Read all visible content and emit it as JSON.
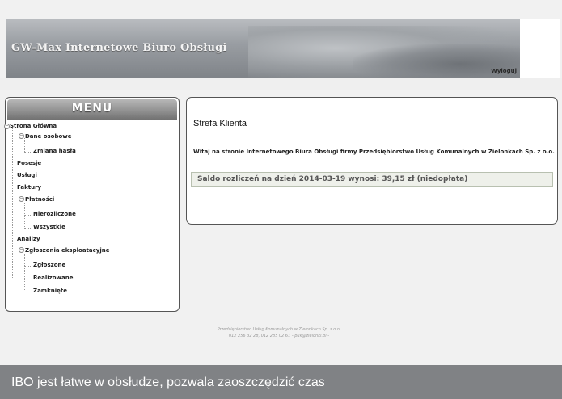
{
  "header": {
    "title": "GW-Max Internetowe Biuro Obsługi",
    "logout": "Wyloguj"
  },
  "menu": {
    "title": "MENU",
    "items": [
      {
        "label": "Strona Główna"
      },
      {
        "label": "Dane osobowe"
      },
      {
        "label": "Zmiana hasła"
      },
      {
        "label": "Posesje"
      },
      {
        "label": "Usługi"
      },
      {
        "label": "Faktury"
      },
      {
        "label": "Płatności"
      },
      {
        "label": "Nierozliczone"
      },
      {
        "label": "Wszystkie"
      },
      {
        "label": "Analizy"
      },
      {
        "label": "Zgłoszenia eksploatacyjne"
      },
      {
        "label": "Zgłoszone"
      },
      {
        "label": "Realizowane"
      },
      {
        "label": "Zamknięte"
      }
    ]
  },
  "main": {
    "title": "Strefa Klienta",
    "welcome": "Witaj na stronie Internetowego Biura Obsługi firmy Przedsiębiorstwo Usług Komunalnych w Zielonkach Sp. z o.o.",
    "balance": "Saldo rozliczeń na dzień 2014-03-19 wynosi: 39,15 zł (niedopłata)"
  },
  "footer": {
    "line1": "Przedsiębiorstwo Usług Komunalnych w Zielonkach Sp. z o.o.",
    "line2": "012 256 32 28, 012 285 02 61 - puk@zielonki.pl -"
  },
  "caption": "IBO jest łatwe w obsłudze, pozwala zaoszczędzić czas"
}
